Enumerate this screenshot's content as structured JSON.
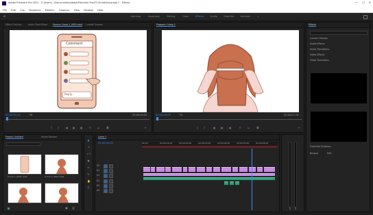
{
  "window": {
    "title": "Adobe Premiere Pro 2021 - C:\\Users\\...\\Documents\\Adobe\\Premiere Pro\\15.0\\Untitled.prproj * - Edited",
    "controls": [
      "—",
      "☐",
      "✕"
    ]
  },
  "menu": [
    "File",
    "Edit",
    "Clip",
    "Sequence",
    "Markers",
    "Graphics",
    "View",
    "Window",
    "Help"
  ],
  "workspaces": {
    "items": [
      "Learning",
      "Assembly",
      "Editing",
      "Color",
      "Effects",
      "Audio",
      "Graphics",
      "Libraries",
      "»"
    ],
    "active_index": 4
  },
  "source_monitor": {
    "tabs": [
      "Effect Controls",
      "Audio Track Mixer",
      "Source: Comp 1_0001.mp4",
      "Lumetri Scopes"
    ],
    "active_tab": 2,
    "timecode": "00;00;00;00",
    "end_timecode": "00;00;00;00",
    "fit": "Fit",
    "phone": {
      "header": "Comment",
      "reply_label": "Reply..."
    }
  },
  "program_monitor": {
    "tabs": [
      "Program: Comp 1"
    ],
    "timecode": "00;00;00;00",
    "end_timecode": "00;00;07;16",
    "fit": "Fit"
  },
  "project_panel": {
    "tabs": [
      "Project: Untitled",
      "Media Browser"
    ],
    "search_placeholder": "",
    "items": [
      {
        "name": "Comp 1_0001.mp4",
        "duration": "7;16"
      },
      {
        "name": "Comp 1_0002.mp4",
        "duration": "7;16"
      },
      {
        "name": "Comp 1",
        "duration": "7;16"
      },
      {
        "name": "Comp 2",
        "duration": "7;16"
      }
    ]
  },
  "timeline": {
    "tabs": [
      "Comp 1"
    ],
    "timecode": "00;00;00;00",
    "ruler": [
      "00;00",
      "00;00;01;00",
      "00;00;02;00",
      "00;00;03;00",
      "00;00;04;00",
      "00;00;05;00",
      "00;00;06;00",
      "00;00;07;00"
    ],
    "tracks": {
      "video": [
        "V3",
        "V2",
        "V1"
      ],
      "audio": [
        "A1",
        "A2",
        "A3"
      ]
    }
  },
  "right_panel": {
    "header": "Effects",
    "items": [
      "Lumetri Presets",
      "Audio Effects",
      "Audio Transitions",
      "Video Effects",
      "Video Transitions"
    ],
    "sections": [
      "Essential Graphics",
      "Browse",
      "Edit"
    ]
  },
  "colors": {
    "accent": "#2d8ceb",
    "video_clip": "#c68ae0",
    "audio_clip": "#2a9e7c",
    "panel_bg": "#232323",
    "playhead": "#3d8ef0"
  }
}
